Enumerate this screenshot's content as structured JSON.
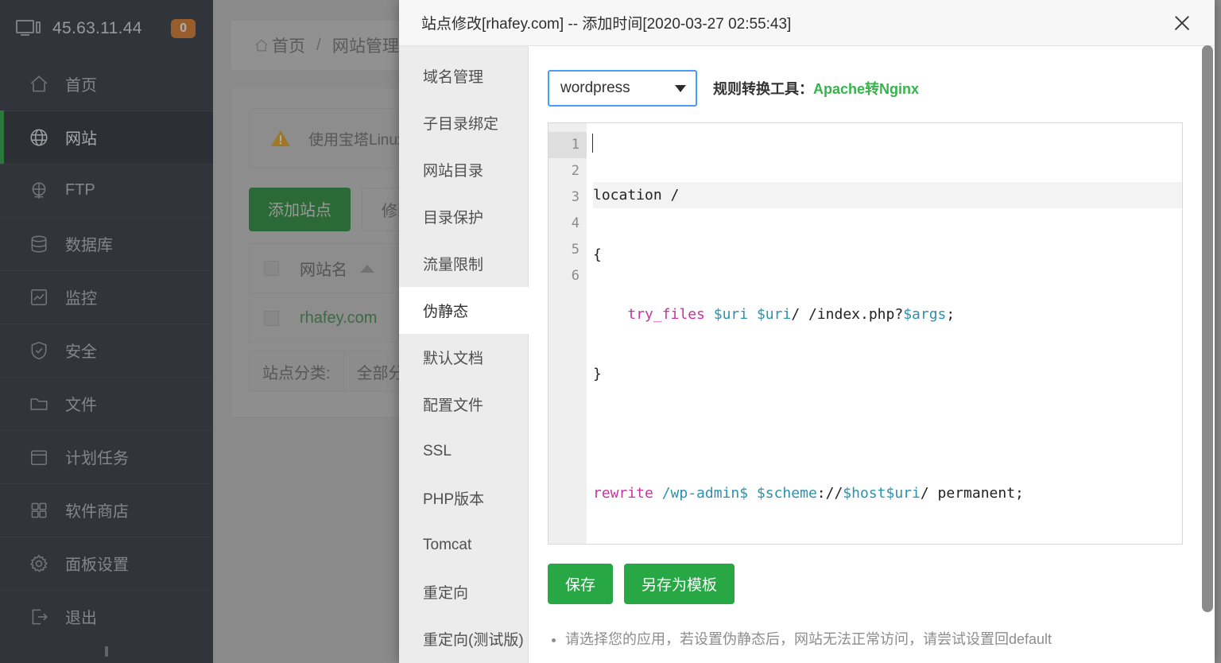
{
  "sidebar": {
    "server_ip": "45.63.11.44",
    "badge_count": "0",
    "monitor_icon": "monitor-icon",
    "items": [
      {
        "label": "首页",
        "icon": "home-icon",
        "active": false
      },
      {
        "label": "网站",
        "icon": "globe-icon",
        "active": true
      },
      {
        "label": "FTP",
        "icon": "ftp-icon",
        "active": false
      },
      {
        "label": "数据库",
        "icon": "database-icon",
        "active": false
      },
      {
        "label": "监控",
        "icon": "chart-icon",
        "active": false
      },
      {
        "label": "安全",
        "icon": "shield-icon",
        "active": false
      },
      {
        "label": "文件",
        "icon": "folder-icon",
        "active": false
      },
      {
        "label": "计划任务",
        "icon": "calendar-icon",
        "active": false
      },
      {
        "label": "软件商店",
        "icon": "grid-icon",
        "active": false
      },
      {
        "label": "面板设置",
        "icon": "gear-icon",
        "active": false
      },
      {
        "label": "退出",
        "icon": "logout-icon",
        "active": false
      }
    ]
  },
  "background": {
    "breadcrumb": {
      "home": "首页",
      "separator": "/",
      "current": "网站管理"
    },
    "alert_text": "使用宝塔Linux面板",
    "buttons": {
      "add_site": "添加站点",
      "modify_default": "修改默认"
    },
    "table": {
      "header": "网站名",
      "rows": [
        {
          "name": "rhafey.com"
        }
      ]
    },
    "filter": {
      "label": "站点分类:",
      "value": "全部分类"
    }
  },
  "modal": {
    "title": "站点修改[rhafey.com] -- 添加时间[2020-03-27 02:55:43]",
    "close_icon": "close-icon",
    "tabs": [
      {
        "label": "域名管理",
        "active": false
      },
      {
        "label": "子目录绑定",
        "active": false
      },
      {
        "label": "网站目录",
        "active": false
      },
      {
        "label": "目录保护",
        "active": false
      },
      {
        "label": "流量限制",
        "active": false
      },
      {
        "label": "伪静态",
        "active": true
      },
      {
        "label": "默认文档",
        "active": false
      },
      {
        "label": "配置文件",
        "active": false
      },
      {
        "label": "SSL",
        "active": false
      },
      {
        "label": "PHP版本",
        "active": false
      },
      {
        "label": "Tomcat",
        "active": false
      },
      {
        "label": "重定向",
        "active": false
      },
      {
        "label": "重定向(测试版)",
        "active": false
      }
    ],
    "rule_select": {
      "value": "wordpress",
      "caret_icon": "chevron-down-icon"
    },
    "converter": {
      "label": "规则转换工具：",
      "link": "Apache转Nginx",
      "link_color": "#35b44c"
    },
    "editor": {
      "line_numbers": [
        "1",
        "2",
        "3",
        "4",
        "5",
        "6"
      ],
      "lines": [
        "location /",
        "{",
        "    try_files $uri $uri/ /index.php?$args;",
        "}",
        "",
        "rewrite /wp-admin$ $scheme://$host$uri/ permanent;"
      ],
      "active_line": 1
    },
    "buttons": {
      "save": "保存",
      "save_as_template": "另存为模板"
    },
    "notes": [
      "请选择您的应用，若设置伪静态后，网站无法正常访问，请尝试设置回default"
    ]
  },
  "colors": {
    "sidebar_bg": "#2b303b",
    "sidebar_active_bg": "#22262f",
    "accent_green": "#20a53a",
    "badge_orange": "#d9781f",
    "button_green": "#28a745",
    "select_border_blue": "#4a9cf5"
  }
}
